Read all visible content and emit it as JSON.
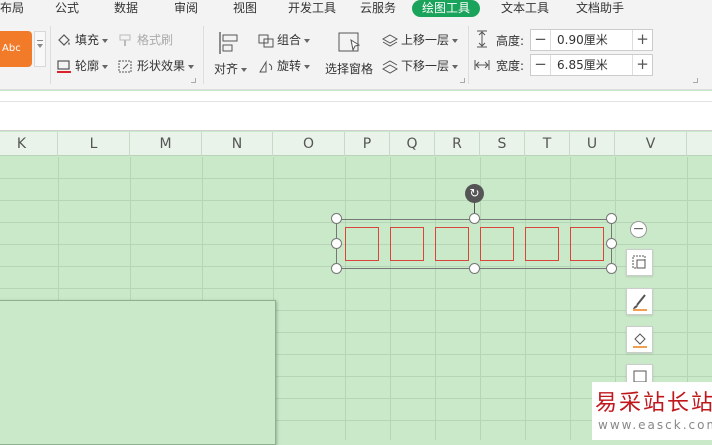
{
  "menu": {
    "items": [
      "布局",
      "公式",
      "数据",
      "审阅",
      "视图",
      "开发工具",
      "云服务",
      "绘图工具",
      "文本工具",
      "文档助手"
    ],
    "active": "绘图工具"
  },
  "ribbon": {
    "style_preview_label": "Abc",
    "fill_label": "填充",
    "format_brush_label": "格式刷",
    "outline_label": "轮廓",
    "shape_effect_label": "形状效果",
    "align_label": "对齐",
    "group_label": "组合",
    "rotate_label": "旋转",
    "selection_pane_label": "选择窗格",
    "bring_forward_label": "上移一层",
    "send_backward_label": "下移一层",
    "height_label": "高度:",
    "height_value": "0.90厘米",
    "width_label": "宽度:",
    "width_value": "6.85厘米"
  },
  "columns": [
    "K",
    "L",
    "M",
    "N",
    "O",
    "P",
    "Q",
    "R",
    "S",
    "T",
    "U",
    "V"
  ],
  "colors": {
    "sheet_bg": "#c9e9c9",
    "active_tab": "#1aa35a",
    "shape_outline": "#d8453a",
    "style_preview": "#f27b2a",
    "watermark_red": "#c0171d"
  },
  "float_toolbar": {
    "icons": [
      "collapse-icon",
      "layout-options-icon",
      "outline-brush-icon",
      "fill-bucket-icon",
      "frame-icon"
    ]
  },
  "watermark": {
    "title": "易采站长站",
    "url": "www.easck.com"
  }
}
